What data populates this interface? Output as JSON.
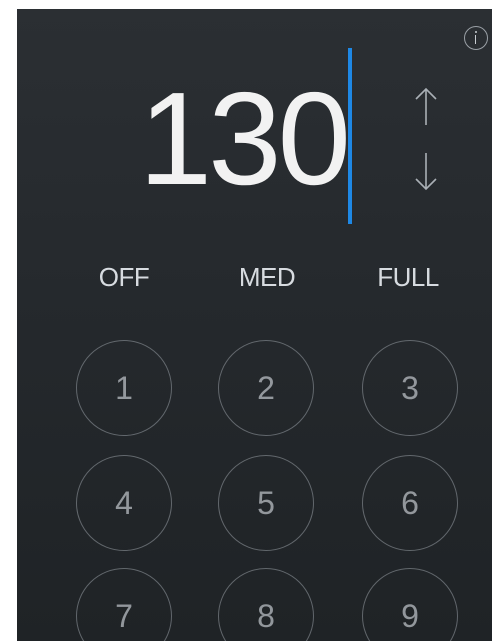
{
  "display": {
    "value": "130",
    "up_arrow_icon": "arrow-up-icon",
    "down_arrow_icon": "arrow-down-icon"
  },
  "presets": {
    "off": "OFF",
    "med": "MED",
    "full": "FULL"
  },
  "keypad": {
    "keys": [
      "1",
      "2",
      "3",
      "4",
      "5",
      "6",
      "7",
      "8",
      "9"
    ]
  },
  "icons": {
    "info": "info-icon"
  },
  "colors": {
    "background": "#25292d",
    "accent_caret": "#1e88e5",
    "text": "#f2f2f2"
  }
}
